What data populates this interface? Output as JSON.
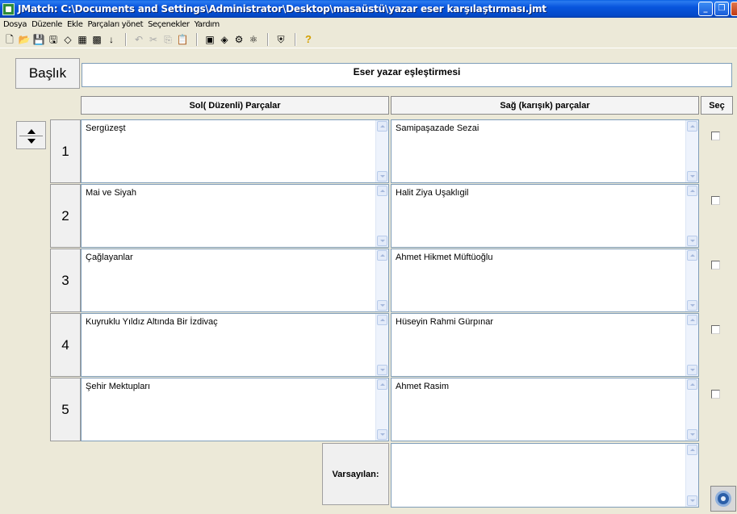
{
  "window": {
    "title": "JMatch: C:\\Documents and Settings\\Administrator\\Desktop\\masaüstü\\yazar eser karşılaştırması.jmt",
    "minimize_label": "_",
    "maximize_label": "❐",
    "close_label": "✕"
  },
  "menu": [
    "Dosya",
    "Düzenle",
    "Ekle",
    "Parçaları yönet",
    "Seçenekler",
    "Yardım"
  ],
  "toolbar": {
    "icons": [
      {
        "name": "new-file-icon",
        "glyph": "🗋",
        "enabled": true
      },
      {
        "name": "open-folder-icon",
        "glyph": "📂",
        "enabled": true
      },
      {
        "name": "save-icon",
        "glyph": "💾",
        "enabled": true
      },
      {
        "name": "save-as-icon",
        "glyph": "🖫",
        "enabled": true
      },
      {
        "name": "clear-icon",
        "glyph": "◇",
        "enabled": true
      },
      {
        "name": "grid-icon",
        "glyph": "▦",
        "enabled": true
      },
      {
        "name": "grid-alt-icon",
        "glyph": "▩",
        "enabled": true
      },
      {
        "name": "down-arrow-icon",
        "glyph": "↓",
        "enabled": true
      },
      {
        "name": "undo-icon",
        "glyph": "↶",
        "enabled": false
      },
      {
        "name": "cut-icon",
        "glyph": "✂",
        "enabled": false
      },
      {
        "name": "copy-icon",
        "glyph": "⎘",
        "enabled": false
      },
      {
        "name": "paste-icon",
        "glyph": "📋",
        "enabled": true
      },
      {
        "name": "export-web-icon",
        "glyph": "▣",
        "enabled": true
      },
      {
        "name": "export-image-icon",
        "glyph": "◈",
        "enabled": true
      },
      {
        "name": "config-icon",
        "glyph": "⚙",
        "enabled": true
      },
      {
        "name": "settings-alt-icon",
        "glyph": "⚛",
        "enabled": true
      },
      {
        "name": "shield-icon",
        "glyph": "⛨",
        "enabled": true
      },
      {
        "name": "help-icon",
        "glyph": "?",
        "enabled": true
      }
    ]
  },
  "header": {
    "baslik_label": "Başlık",
    "title_value": "Eser yazar eşleştirmesi"
  },
  "columns": {
    "left": "Sol( Düzenli) Parçalar",
    "right": "Sağ (karışık) parçalar",
    "select": "Seç"
  },
  "rows": [
    {
      "num": "1",
      "left": "Sergüzeşt",
      "right": "Samipaşazade Sezai",
      "checked": false
    },
    {
      "num": "2",
      "left": "Mai ve Siyah",
      "right": "Halit Ziya Uşaklıgil",
      "checked": false
    },
    {
      "num": "3",
      "left": "Çağlayanlar",
      "right": "Ahmet Hikmet Müftüoğlu",
      "checked": false
    },
    {
      "num": "4",
      "left": "Kuyruklu Yıldız Altında Bir İzdivaç",
      "right": "Hüseyin Rahmi Gürpınar",
      "checked": false
    },
    {
      "num": "5",
      "left": "Şehir Mektupları",
      "right": "Ahmet Rasim",
      "checked": false
    }
  ],
  "defaults": {
    "label": "Varsayılan:",
    "value": ""
  }
}
